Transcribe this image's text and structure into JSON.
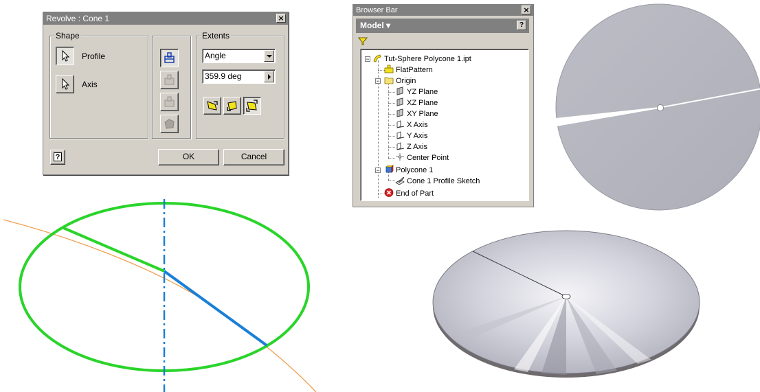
{
  "revolve_dialog": {
    "title": "Revolve : Cone 1",
    "close_glyph": "×",
    "shape_group": "Shape",
    "profile_label": "Profile",
    "axis_label": "Axis",
    "extents_group": "Extents",
    "extents_value": "Angle",
    "angle_value": "359.9 deg",
    "help_glyph": "?",
    "ok_label": "OK",
    "cancel_label": "Cancel"
  },
  "browser_bar": {
    "title": "Browser Bar",
    "close_glyph": "×",
    "header": "Model ▾",
    "help_glyph": "?",
    "tree": [
      {
        "label": "Tut-Sphere Polycone 1.ipt",
        "icon": "part-icon"
      },
      {
        "label": "FlatPattern",
        "icon": "flat-pattern-icon"
      },
      {
        "label": "Origin",
        "icon": "folder-icon"
      },
      {
        "label": "YZ Plane",
        "icon": "plane-icon"
      },
      {
        "label": "XZ Plane",
        "icon": "plane-icon"
      },
      {
        "label": "XY Plane",
        "icon": "plane-icon"
      },
      {
        "label": "X Axis",
        "icon": "axis-icon"
      },
      {
        "label": "Y Axis",
        "icon": "axis-icon"
      },
      {
        "label": "Z Axis",
        "icon": "axis-icon"
      },
      {
        "label": "Center Point",
        "icon": "point-icon"
      },
      {
        "label": "Polycone 1",
        "icon": "revolve-feature-icon"
      },
      {
        "label": "Cone 1 Profile Sketch",
        "icon": "sketch-icon"
      },
      {
        "label": "End of Part",
        "icon": "end-of-part-icon"
      }
    ]
  },
  "colors": {
    "dialog_face": "#d4d0c8",
    "titlebar": "#808080",
    "sketch_green": "#2ad42a",
    "axis_blue": "#1a7fd8",
    "curve_orange": "#f0a050",
    "disc_grey": "#b4b4be"
  }
}
